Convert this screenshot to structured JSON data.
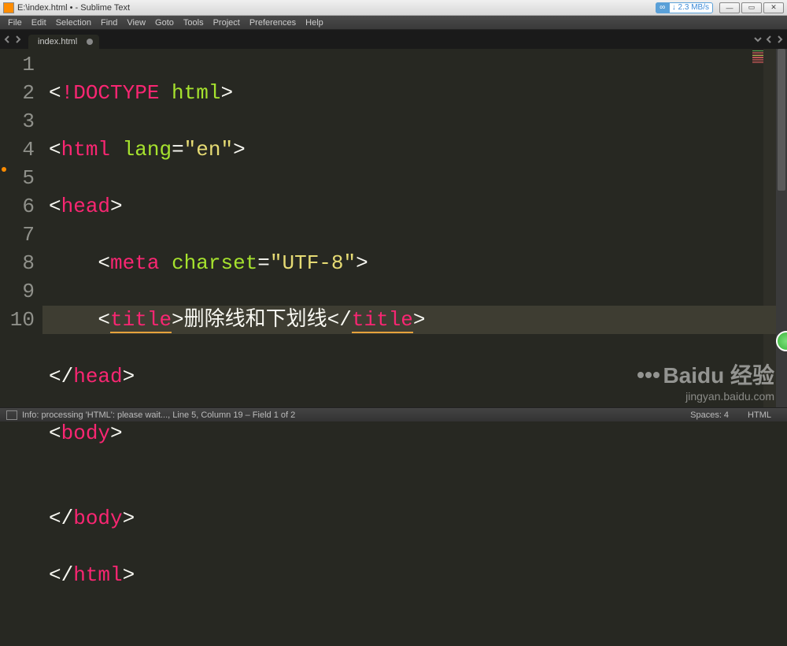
{
  "window": {
    "title": "E:\\index.html • - Sublime Text",
    "net_speed": "↓ 2.3 MB/s"
  },
  "menu": {
    "items": [
      "File",
      "Edit",
      "Selection",
      "Find",
      "View",
      "Goto",
      "Tools",
      "Project",
      "Preferences",
      "Help"
    ]
  },
  "tab": {
    "name": "index.html"
  },
  "gutter": {
    "lines": [
      "1",
      "2",
      "3",
      "4",
      "5",
      "6",
      "7",
      "8",
      "9",
      "10"
    ]
  },
  "code": {
    "l1": {
      "lt": "<",
      "bang": "!",
      "doctype": "DOCTYPE",
      "sp": " ",
      "html": "html",
      "gt": ">"
    },
    "l2": {
      "lt": "<",
      "tag": "html",
      "sp": " ",
      "attr": "lang",
      "eq": "=",
      "q1": "\"",
      "val": "en",
      "q2": "\"",
      "gt": ">"
    },
    "l3": {
      "lt": "<",
      "tag": "head",
      "gt": ">"
    },
    "l4": {
      "indent": "    ",
      "lt": "<",
      "tag": "meta",
      "sp": " ",
      "attr": "charset",
      "eq": "=",
      "q1": "\"",
      "val": "UTF-8",
      "q2": "\"",
      "gt": ">"
    },
    "l5": {
      "indent": "    ",
      "lt": "<",
      "open": "title",
      "gt1": ">",
      "text": "删除线和下划线",
      "lt2": "</",
      "close": "title",
      "gt2": ">"
    },
    "l6": {
      "lt": "</",
      "tag": "head",
      "gt": ">"
    },
    "l7": {
      "lt": "<",
      "tag": "body",
      "gt": ">"
    },
    "l8": {
      "blank": ""
    },
    "l9": {
      "lt": "</",
      "tag": "body",
      "gt": ">"
    },
    "l10": {
      "lt": "</",
      "tag": "html",
      "gt": ">"
    }
  },
  "status": {
    "info": "Info: processing 'HTML': please wait..., Line 5, Column 19 – Field 1 of 2",
    "spaces": "Spaces: 4",
    "syntax": "HTML"
  },
  "watermark": {
    "main": "Baidu 经验",
    "sub": "jingyan.baidu.com"
  }
}
